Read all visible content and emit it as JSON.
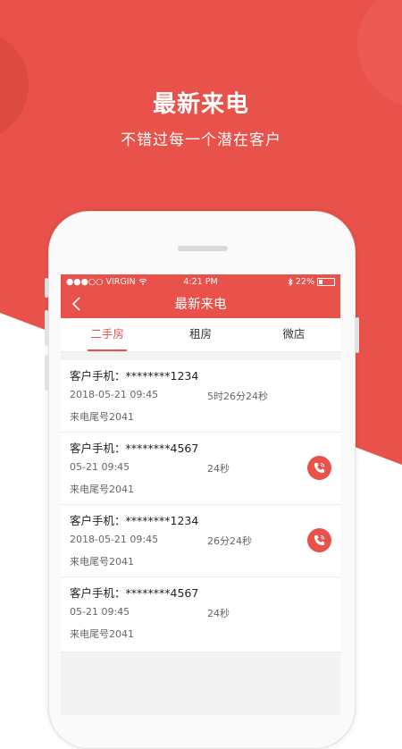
{
  "hero": {
    "title": "最新来电",
    "subtitle": "不错过每一个潜在客户"
  },
  "status_bar": {
    "carrier": "●●●○○ VIRGIN",
    "time": "4:21 PM",
    "battery": "22%"
  },
  "nav": {
    "title": "最新来电"
  },
  "tabs": [
    {
      "label": "二手房",
      "active": true
    },
    {
      "label": "租房",
      "active": false
    },
    {
      "label": "微店",
      "active": false
    }
  ],
  "calls": [
    {
      "customer": "客户手机：********1234",
      "datetime": "2018-05-21  09:45",
      "duration": "5时26分24秒",
      "tail": "来电尾号2041",
      "has_call_button": false
    },
    {
      "customer": "客户手机：********4567",
      "datetime": "05-21  09:45",
      "duration": "24秒",
      "tail": "来电尾号2041",
      "has_call_button": true
    },
    {
      "customer": "客户手机：********1234",
      "datetime": "2018-05-21  09:45",
      "duration": "26分24秒",
      "tail": "来电尾号2041",
      "has_call_button": true
    },
    {
      "customer": "客户手机：********4567",
      "datetime": "05-21  09:45",
      "duration": "24秒",
      "tail": "来电尾号2041",
      "has_call_button": false
    }
  ],
  "colors": {
    "accent": "#e8524a",
    "accent_dark": "#d94a41",
    "background": "#ffffff"
  }
}
